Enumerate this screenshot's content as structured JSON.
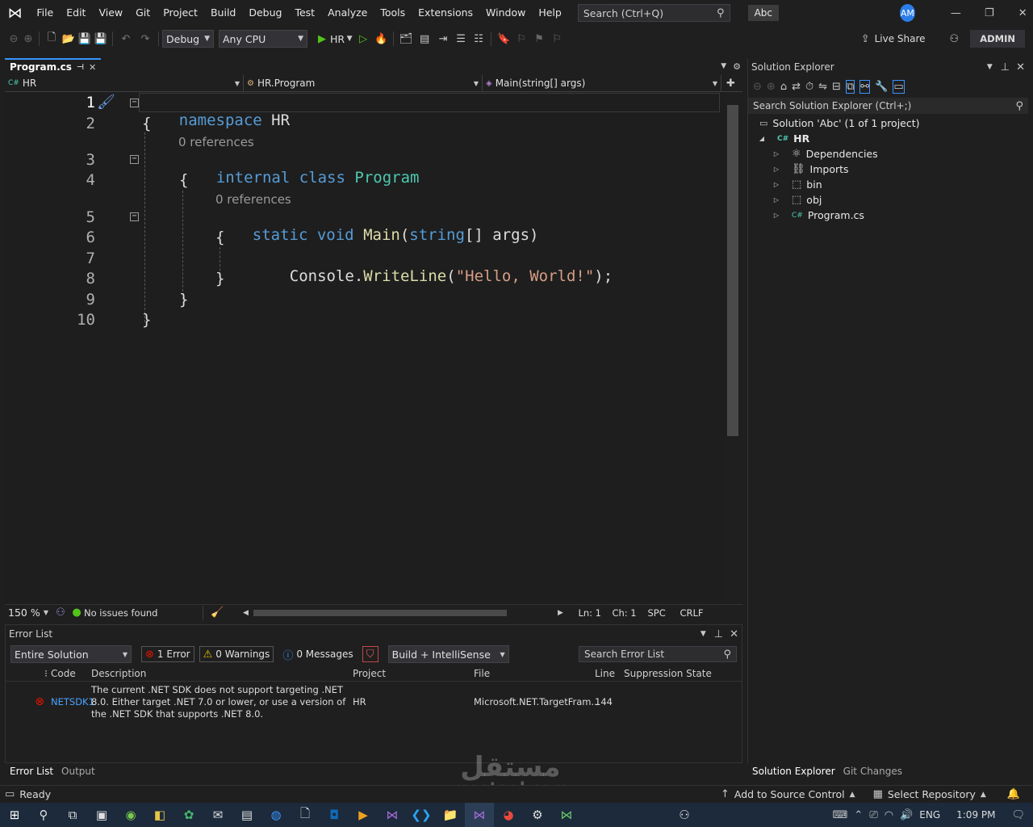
{
  "menubar": {
    "items": [
      "File",
      "Edit",
      "View",
      "Git",
      "Project",
      "Build",
      "Debug",
      "Test",
      "Analyze",
      "Tools",
      "Extensions",
      "Window",
      "Help"
    ],
    "search_placeholder": "Search (Ctrl+Q)",
    "badge": "Abc",
    "avatar": "AM"
  },
  "toolbar": {
    "config": "Debug",
    "platform": "Any CPU",
    "run_target": "HR",
    "live_share": "Live Share",
    "admin": "ADMIN"
  },
  "editor": {
    "tab_label": "Program.cs",
    "nav": {
      "project": "HR",
      "class": "HR.Program",
      "member": "Main(string[] args)"
    },
    "references_label": "0 references",
    "line_numbers": [
      "1",
      "2",
      "3",
      "4",
      "5",
      "6",
      "7",
      "8",
      "9",
      "10"
    ],
    "code": {
      "l1_kw": "namespace",
      "l1_name": " HR",
      "brace_open": "{",
      "brace_close": "}",
      "l3_kw1": "internal",
      "l3_kw2": "class",
      "l3_type": "Program",
      "l5_kw1": "static",
      "l5_kw2": "void",
      "l5_fn": "Main",
      "l5_paren": "(",
      "l5_kw3": "string",
      "l5_rest": "[] args)",
      "l7_type": "Console",
      "l7_dot": ".",
      "l7_fn": "WriteLine",
      "l7_open": "(",
      "l7_str": "\"Hello, World!\"",
      "l7_close": ");"
    },
    "status": {
      "zoom": "150 %",
      "issues": "No issues found",
      "ln": "Ln: 1",
      "ch": "Ch: 1",
      "spc": "SPC",
      "crlf": "CRLF"
    }
  },
  "error_list": {
    "title": "Error List",
    "scope": "Entire Solution",
    "errors": "1 Error",
    "warnings": "0 Warnings",
    "messages": "0 Messages",
    "build_filter": "Build + IntelliSense",
    "search_placeholder": "Search Error List",
    "columns": [
      "Code",
      "Description",
      "Project",
      "File",
      "Line",
      "Suppression State"
    ],
    "rows": [
      {
        "code": "NETSDK1",
        "description": "The current .NET SDK does not support targeting .NET 8.0. Either target .NET 7.0 or lower, or use a version of the .NET SDK that supports .NET 8.0.",
        "project": "HR",
        "file": "Microsoft.NET.TargetFram...",
        "line": "144",
        "suppression": ""
      }
    ]
  },
  "solution_explorer": {
    "title": "Solution Explorer",
    "search_placeholder": "Search Solution Explorer (Ctrl+;)",
    "solution": "Solution 'Abc' (1 of 1 project)",
    "project": "HR",
    "children": [
      "Dependencies",
      "Imports",
      "bin",
      "obj",
      "Program.cs"
    ]
  },
  "bottom_tabs": [
    "Error List",
    "Output"
  ],
  "sol_tabs": [
    "Solution Explorer",
    "Git Changes"
  ],
  "statusbar": {
    "ready": "Ready",
    "source_control": "Add to Source Control",
    "repository": "Select Repository"
  },
  "taskbar": {
    "lang": "ENG",
    "time": "1:09 PM"
  },
  "watermark": {
    "arabic": "مستقل",
    "latin": "mostaql.com"
  },
  "colors": {
    "accent": "#3794ff",
    "error": "#e51400",
    "keyword": "#569cd6",
    "type": "#4ec9b0",
    "function": "#dcdcaa",
    "string": "#d69d85"
  }
}
